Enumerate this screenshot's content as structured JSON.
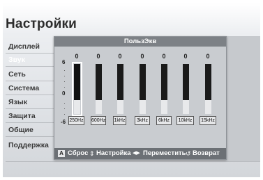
{
  "page": {
    "title": "Настройки"
  },
  "sidebar": {
    "items": [
      {
        "label": "Дисплей",
        "active": false
      },
      {
        "label": "Звук",
        "active": true
      },
      {
        "label": "Сеть",
        "active": false
      },
      {
        "label": "Система",
        "active": false
      },
      {
        "label": "Язык",
        "active": false
      },
      {
        "label": "Защита",
        "active": false
      },
      {
        "label": "Общие",
        "active": false
      },
      {
        "label": "Поддержка",
        "active": false
      }
    ]
  },
  "dialog": {
    "title": "ПользЭкв",
    "scale": {
      "max_label": "6",
      "zero_label": "0",
      "min_label": "-6",
      "min": -6,
      "max": 6
    },
    "bands": [
      {
        "freq": "250Hz",
        "value_label": "0",
        "value": 0,
        "selected": true
      },
      {
        "freq": "600Hz",
        "value_label": "0",
        "value": 0,
        "selected": false
      },
      {
        "freq": "1kHz",
        "value_label": "0",
        "value": 0,
        "selected": false
      },
      {
        "freq": "3kHz",
        "value_label": "0",
        "value": 0,
        "selected": false
      },
      {
        "freq": "6kHz",
        "value_label": "0",
        "value": 0,
        "selected": false
      },
      {
        "freq": "10kHz",
        "value_label": "0",
        "value": 0,
        "selected": false
      },
      {
        "freq": "15kHz",
        "value_label": "0",
        "value": 0,
        "selected": false
      }
    ]
  },
  "help": {
    "reset_key": "A",
    "reset_label": "Сброс",
    "adjust_icon": "up-down-arrows-icon",
    "adjust_label": "Настройка",
    "move_icon": "left-right-arrows-icon",
    "move_label": "Переместить",
    "return_icon": "return-icon",
    "return_label": "Возврат"
  }
}
